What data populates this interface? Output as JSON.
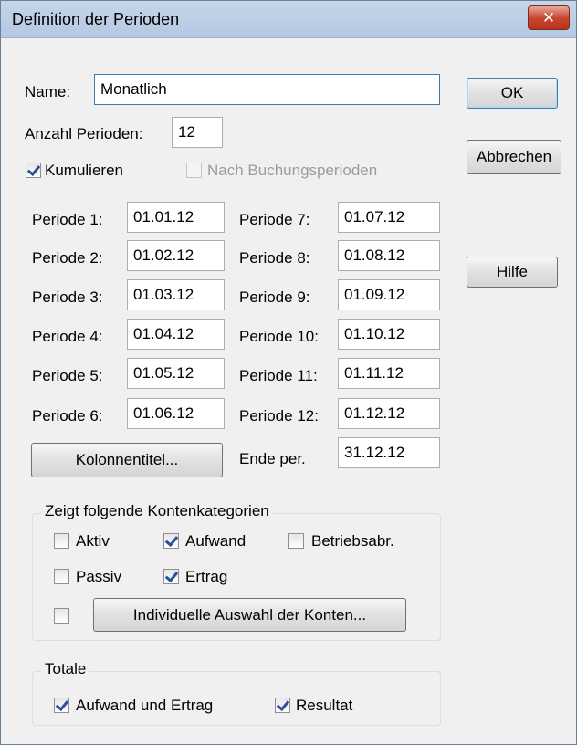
{
  "window": {
    "title": "Definition der Perioden",
    "close_symbol": "✕"
  },
  "form": {
    "name_label": "Name:",
    "name_value": "Monatlich",
    "count_label": "Anzahl Perioden:",
    "count_value": "12",
    "kumulieren_label": "Kumulieren",
    "kumulieren_checked": true,
    "buchungsperioden_label": "Nach Buchungsperioden",
    "buchungsperioden_checked": false
  },
  "periods": [
    {
      "label": "Periode 1:",
      "value": "01.01.12"
    },
    {
      "label": "Periode 2:",
      "value": "01.02.12"
    },
    {
      "label": "Periode 3:",
      "value": "01.03.12"
    },
    {
      "label": "Periode 4:",
      "value": "01.04.12"
    },
    {
      "label": "Periode 5:",
      "value": "01.05.12"
    },
    {
      "label": "Periode 6:",
      "value": "01.06.12"
    },
    {
      "label": "Periode 7:",
      "value": "01.07.12"
    },
    {
      "label": "Periode 8:",
      "value": "01.08.12"
    },
    {
      "label": "Periode 9:",
      "value": "01.09.12"
    },
    {
      "label": "Periode 10:",
      "value": "01.10.12"
    },
    {
      "label": "Periode 11:",
      "value": "01.11.12"
    },
    {
      "label": "Periode 12:",
      "value": "01.12.12"
    }
  ],
  "end": {
    "label": "Ende per.",
    "value": "31.12.12"
  },
  "buttons": {
    "ok": "OK",
    "cancel": "Abbrechen",
    "help": "Hilfe",
    "column_titles": "Kolonnentitel...",
    "individual_selection": "Individuelle Auswahl der Konten..."
  },
  "categories": {
    "title": "Zeigt folgende Kontenkategorien",
    "aktiv": {
      "label": "Aktiv",
      "checked": false
    },
    "aufwand": {
      "label": "Aufwand",
      "checked": true
    },
    "betriebsabr": {
      "label": "Betriebsabr.",
      "checked": false
    },
    "passiv": {
      "label": "Passiv",
      "checked": false
    },
    "ertrag": {
      "label": "Ertrag",
      "checked": true
    },
    "individual": {
      "checked": false
    }
  },
  "totals": {
    "title": "Totale",
    "aufwand_ertrag": {
      "label": "Aufwand und Ertrag",
      "checked": true
    },
    "resultat": {
      "label": "Resultat",
      "checked": true
    }
  }
}
